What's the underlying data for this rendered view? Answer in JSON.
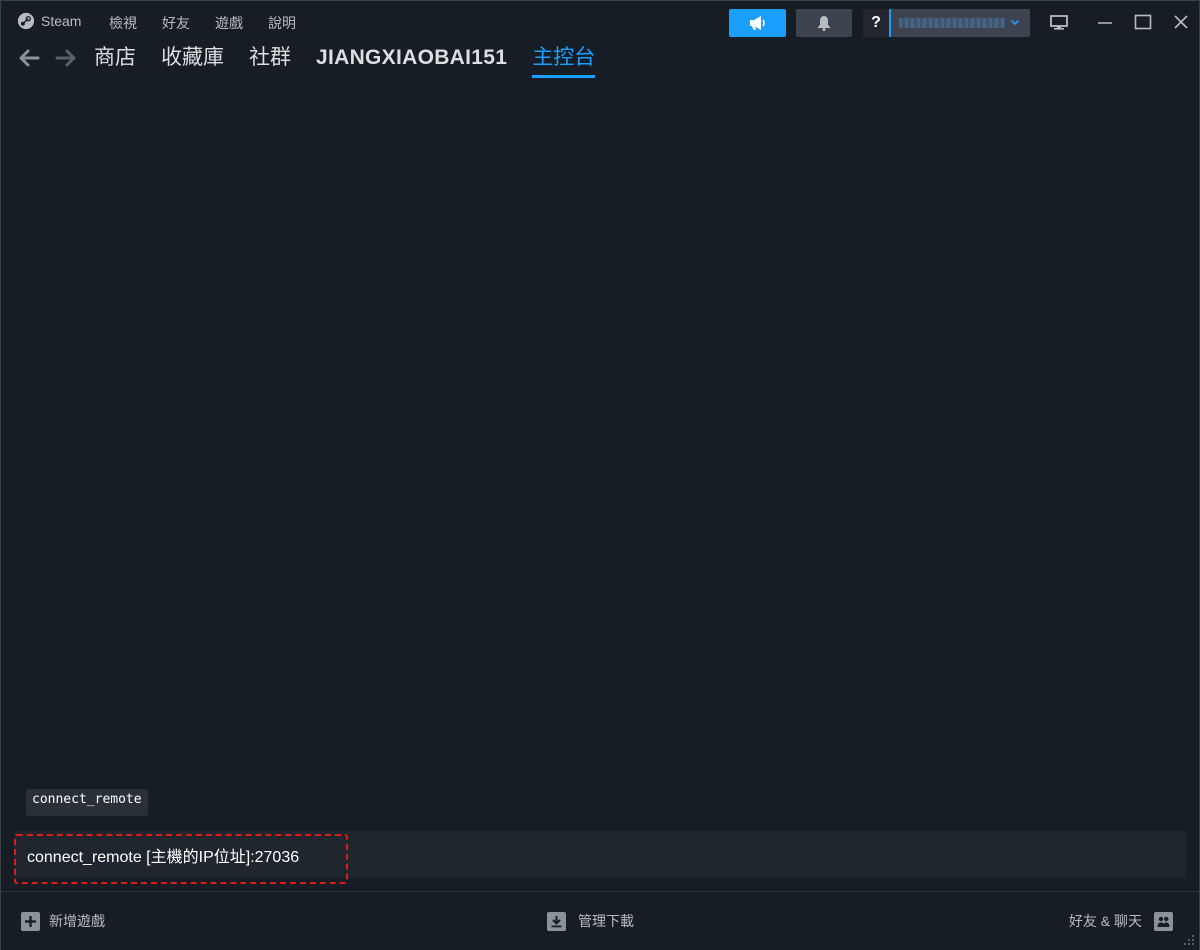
{
  "app": {
    "title": "Steam"
  },
  "menu": {
    "items": [
      "檢視",
      "好友",
      "遊戲",
      "說明"
    ]
  },
  "titlebar": {
    "help_label": "?",
    "colors": {
      "accent": "#1a9fff",
      "button_bg": "#3d4450"
    }
  },
  "nav": {
    "links": [
      {
        "label": "商店"
      },
      {
        "label": "收藏庫"
      },
      {
        "label": "社群"
      },
      {
        "label": "JIANGXIAOBAI151"
      },
      {
        "label": "主控台",
        "active": true
      }
    ]
  },
  "console": {
    "suggestion": "connect_remote",
    "input_value": "connect_remote [主機的IP位址]:27036",
    "highlight_color": "#e01b1b"
  },
  "bottombar": {
    "add_game": "新增遊戲",
    "downloads": "管理下載",
    "friends_chat": "好友 & 聊天"
  }
}
